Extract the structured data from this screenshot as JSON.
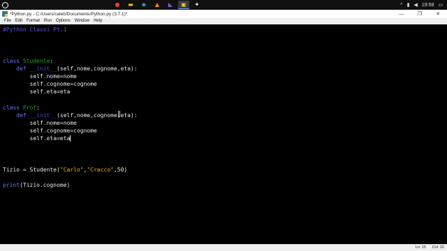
{
  "taskbar": {
    "apps": [
      {
        "icon": "chrome-icon",
        "glyph": "●",
        "color": "#e34133"
      },
      {
        "icon": "folder-icon",
        "glyph": "▬",
        "color": "#f2c530"
      },
      {
        "icon": "python-icon",
        "glyph": "◆",
        "color": "#4b8bbe"
      },
      {
        "icon": "vlc-icon",
        "glyph": "▲",
        "color": "#f08c00"
      },
      {
        "icon": "visual-studio-icon",
        "glyph": "◣",
        "color": "#8e5bd8"
      },
      {
        "icon": "idle-icon",
        "glyph": "▣",
        "color": "#f2c530"
      },
      {
        "icon": "app-icon",
        "glyph": "✦",
        "color": "#ffffff"
      }
    ],
    "clock": "19:58"
  },
  "window": {
    "title": "*Python.py - C:/Users/caleb/Documents/Python.py (3.7.1)*",
    "minimize": "—",
    "maximize": "❐",
    "close": "✕"
  },
  "menu": [
    "File",
    "Edit",
    "Format",
    "Run",
    "Options",
    "Window",
    "Help"
  ],
  "code_lines": [
    [
      {
        "t": "#Python Classi Pt.1",
        "c": "cmt"
      }
    ],
    [],
    [],
    [],
    [
      {
        "t": "class ",
        "c": "kw"
      },
      {
        "t": "Studente",
        "c": "cls"
      },
      {
        "t": ":",
        "c": ""
      }
    ],
    [
      {
        "t": "    ",
        "c": ""
      },
      {
        "t": "def ",
        "c": "kw"
      },
      {
        "t": "__init__",
        "c": "fn"
      },
      {
        "t": "(self,nome,cognome,eta):",
        "c": ""
      }
    ],
    [
      {
        "t": "        self.nome=nome",
        "c": ""
      }
    ],
    [
      {
        "t": "        self.cognome=cognome",
        "c": ""
      }
    ],
    [
      {
        "t": "        self.eta=eta",
        "c": ""
      }
    ],
    [],
    [
      {
        "t": "class ",
        "c": "kw"
      },
      {
        "t": "Prof",
        "c": "cls"
      },
      {
        "t": ":",
        "c": ""
      }
    ],
    [
      {
        "t": "    ",
        "c": ""
      },
      {
        "t": "def ",
        "c": "kw"
      },
      {
        "t": "__init__",
        "c": "fn"
      },
      {
        "t": "(self,nome,cognome,eta):",
        "c": ""
      }
    ],
    [
      {
        "t": "        self.nome=nome",
        "c": ""
      }
    ],
    [
      {
        "t": "        self.cognome=cognome",
        "c": ""
      }
    ],
    [
      {
        "t": "        self.eta=eta",
        "c": ""
      },
      {
        "caret": true
      }
    ],
    [],
    [],
    [],
    [
      {
        "t": "Tizio = Studente(",
        "c": ""
      },
      {
        "t": "\"Carlo\"",
        "c": "str"
      },
      {
        "t": ",",
        "c": ""
      },
      {
        "t": "\"Cracco\"",
        "c": "str"
      },
      {
        "t": ",50)",
        "c": ""
      }
    ],
    [],
    [
      {
        "t": "print",
        "c": "kw"
      },
      {
        "t": "(Tizio.cognome)",
        "c": ""
      }
    ]
  ],
  "status": {
    "line": "Ln: 15",
    "col": "Col: 20"
  }
}
